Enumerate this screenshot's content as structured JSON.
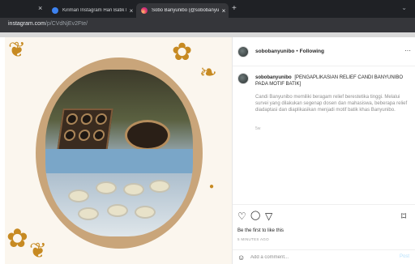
{
  "browser": {
    "tabs": [
      {
        "title": "Kiriman Instagram Hari Batik Na",
        "active": false
      },
      {
        "title": "Sobo Banyunibo (@sobobanyuni",
        "active": true
      }
    ],
    "close_glyph": "×",
    "new_tab_glyph": "+",
    "menu_glyph": "⌄",
    "url_host": "instagram.com",
    "url_path": "/p/CVdNjEv2Fte/"
  },
  "post": {
    "username": "sobobanyunibo",
    "separator": "•",
    "follow_label": "Following",
    "more_glyph": "···",
    "caption_username": "sobobanyunibo",
    "caption_text": "[PENGAPLIKASIAN RELIEF CANDI BANYUNIBO PADA MOTIF BATIK]",
    "body_text": "Candi Banyunibo memiliki beragam relief berestetika tinggi. Melalui survei yang dilakukan segenap dosen dan mahasiswa, beberapa relief diadaptasi dan diaplikasikan menjadi motif batik khas Banyunibo.",
    "time_short": "5w",
    "likes_text": "Be the first to like this",
    "posted_ago": "5 MINUTES AGO",
    "comment_placeholder": "Add a comment...",
    "post_label": "Post"
  },
  "icons": {
    "heart": "♡",
    "comment": "◯",
    "share": "▽",
    "bookmark": "⌑",
    "emoji": "☺"
  },
  "colors": {
    "tabbar": "#1f2125",
    "addressbar": "#35363a",
    "frame": "#c9a57a",
    "ornament": "#c78a22",
    "post_button": "#b2dffc"
  }
}
